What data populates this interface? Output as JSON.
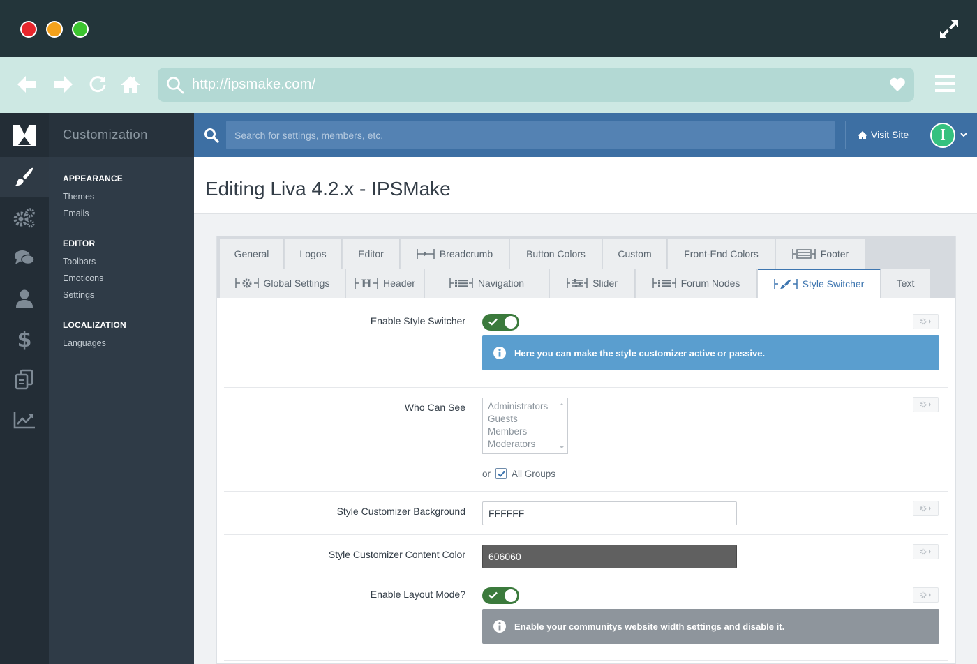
{
  "browser": {
    "url": "http://ipsmake.com/"
  },
  "sidebar": {
    "title": "Customization",
    "groups": [
      {
        "title": "APPEARANCE",
        "items": [
          "Themes",
          "Emails"
        ]
      },
      {
        "title": "EDITOR",
        "items": [
          "Toolbars",
          "Emoticons",
          "Settings"
        ]
      },
      {
        "title": "LOCALIZATION",
        "items": [
          "Languages"
        ]
      }
    ],
    "rail_icons": [
      "paintbrush-icon",
      "gears-icon",
      "chat-icon",
      "user-icon",
      "dollar-icon",
      "documents-icon",
      "stats-icon"
    ]
  },
  "topbar": {
    "search_placeholder": "Search for settings, members, etc.",
    "visit_site": "Visit Site",
    "avatar_letter": "I"
  },
  "page": {
    "title": "Editing Liva 4.2.x - IPSMake"
  },
  "tabs": {
    "row1": [
      "General",
      "Logos",
      "Editor",
      "Breadcrumb",
      "Button Colors",
      "Custom",
      "Front-End Colors",
      "Footer"
    ],
    "row2": [
      "Global Settings",
      "Header",
      "Navigation",
      "Slider",
      "Forum Nodes",
      "Style Switcher",
      "Text"
    ],
    "active": "Style Switcher"
  },
  "form": {
    "enable_style_switcher": {
      "label": "Enable Style Switcher",
      "value": true,
      "info": "Here you can make the style customizer active or passive."
    },
    "who_can_see": {
      "label": "Who Can See",
      "options": [
        "Administrators",
        "Guests",
        "Members",
        "Moderators"
      ],
      "or_text": "or",
      "all_groups_label": "All Groups",
      "all_groups_checked": true
    },
    "bg_color": {
      "label": "Style Customizer Background",
      "value": "FFFFFF"
    },
    "content_color": {
      "label": "Style Customizer Content Color",
      "value": "606060"
    },
    "layout_mode": {
      "label": "Enable Layout Mode?",
      "value": true,
      "info": "Enable your communitys website width settings and disable it."
    }
  },
  "colors": {
    "titlebar": "#23353a",
    "navbar": "#cde8e3",
    "admin_bar": "#3d6fa3",
    "accent": "#3e76b0",
    "toggle_on": "#3b7a3c",
    "info_blue": "#5a9ecf",
    "info_gray": "#8e959c",
    "content_swatch": "#606060"
  }
}
